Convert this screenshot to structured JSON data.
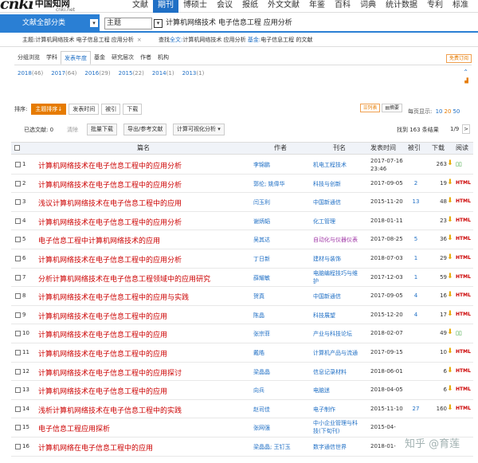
{
  "topnav": {
    "logo_text": "cnki",
    "logo_cn": "中国知网",
    "logo_domain": "cnki.net",
    "items": [
      "文献",
      "期刊",
      "博硕士",
      "会议",
      "报纸",
      "外文文献",
      "年鉴",
      "百科",
      "词典",
      "统计数据",
      "专利",
      "标准"
    ],
    "active_index": 1
  },
  "search": {
    "scope": "文献全部分类",
    "field": "主题",
    "query": "计算机网络技术 电子信息工程 应用分析"
  },
  "breadcrumb": {
    "left": "主题:计算机网络技术 电子信息工程 应用分析",
    "close": "×",
    "right_prefix": "查找",
    "right_bold": "全文:",
    "right_middle": "计算机网络技术 应用分析",
    "right_bold2": "基金:",
    "right_end": "电子信息工程 的文献"
  },
  "filters": {
    "items": [
      "分组浏览",
      "学科",
      "发表年度",
      "基金",
      "研究层次",
      "作者",
      "机构"
    ],
    "selected_index": 2,
    "right_button": "免费订阅"
  },
  "years": [
    {
      "y": "2018",
      "n": "(46)"
    },
    {
      "y": "2017",
      "n": "(64)"
    },
    {
      "y": "2016",
      "n": "(29)"
    },
    {
      "y": "2015",
      "n": "(22)"
    },
    {
      "y": "2014",
      "n": "(1)"
    },
    {
      "y": "2013",
      "n": "(1)"
    }
  ],
  "sort": {
    "label": "排序:",
    "options": [
      "主题排序↓",
      "发表时间",
      "被引",
      "下载"
    ],
    "active_index": 0
  },
  "view": {
    "list": "☰列表",
    "abstract": "▤摘要"
  },
  "pagesize": {
    "label": "每页显示:",
    "options": [
      "10",
      "20",
      "50"
    ],
    "active_index": 1
  },
  "actions": {
    "selected": "已选文献: 0",
    "clear": "清除",
    "batch_download": "批量下载",
    "export": "导出/参考文献",
    "viz": "计算可视化分析 ▾",
    "found": "找到 163 条结果",
    "page": "1/9",
    "next": ">"
  },
  "table": {
    "headers": {
      "title": "篇名",
      "author": "作者",
      "journal": "刊名",
      "date": "发表时间",
      "cite": "被引",
      "download": "下载",
      "read": "阅读"
    },
    "rows": [
      {
        "num": "1",
        "title": "计算机网络技术在电子信息工程中的应用分析",
        "author": "李锦鹏",
        "journal": "机电工程技术",
        "date": "2017-07-16 23:46",
        "cite": "",
        "download": "263",
        "read": "book"
      },
      {
        "num": "2",
        "title": "计算机网络技术在电子信息工程中的应用分析",
        "author": "郭伦; 姚偉华",
        "journal": "科技与创新",
        "date": "2017-09-05",
        "cite": "2",
        "download": "19",
        "read": "HTML"
      },
      {
        "num": "3",
        "title": "浅议计算机网络技术在电子信息工程中的应用",
        "author": "闫玉利",
        "journal": "中国新通信",
        "date": "2015-11-20",
        "cite": "13",
        "download": "48",
        "read": "HTML"
      },
      {
        "num": "4",
        "title": "计算机网络技术在电子信息工程中的应用分析",
        "author": "谢炳韬",
        "journal": "化工管理",
        "date": "2018-01-11",
        "cite": "",
        "download": "23",
        "read": "HTML"
      },
      {
        "num": "5",
        "title": "电子信息工程中计算机网络技术的应用",
        "author": "吴其达",
        "journal": "自动化与仪器仪表",
        "date": "2017-08-25",
        "cite": "5",
        "download": "36",
        "read": "HTML",
        "journal_purple": true
      },
      {
        "num": "6",
        "title": "计算机网络技术在电子信息工程中的应用分析",
        "author": "丁日新",
        "journal": "建材与装饰",
        "date": "2018-07-03",
        "cite": "1",
        "download": "29",
        "read": "HTML"
      },
      {
        "num": "7",
        "title": "分析计算机网络技术在电子信息工程领域中的应用研究",
        "author": "薛耀敏",
        "journal": "电脑编程技巧与维护",
        "date": "2017-12-03",
        "cite": "1",
        "download": "59",
        "read": "HTML"
      },
      {
        "num": "8",
        "title": "计算机网络技术在电子信息工程中的应用与实践",
        "author": "贺真",
        "journal": "中国新通信",
        "date": "2017-09-05",
        "cite": "4",
        "download": "16",
        "read": "HTML"
      },
      {
        "num": "9",
        "title": "计算机网络技术在电子信息工程中的应用",
        "author": "陈晶",
        "journal": "科技展望",
        "date": "2015-12-20",
        "cite": "4",
        "download": "17",
        "read": "HTML"
      },
      {
        "num": "10",
        "title": "计算机网络技术在电子信息工程中的应用",
        "author": "张宗菲",
        "journal": "产业与科技论坛",
        "date": "2018-02-07",
        "cite": "",
        "download": "49",
        "read": "book"
      },
      {
        "num": "11",
        "title": "计算机网络技术在电子信息工程中的应用",
        "author": "戴皓",
        "journal": "计算机产品与流通",
        "date": "2017-09-15",
        "cite": "",
        "download": "10",
        "read": "HTML"
      },
      {
        "num": "12",
        "title": "计算机网络技术在电子信息工程中的应用探讨",
        "author": "梁晶晶",
        "journal": "信息记录材料",
        "date": "2018-06-01",
        "cite": "",
        "download": "6",
        "read": "HTML"
      },
      {
        "num": "13",
        "title": "计算机网络技术在电子信息工程中的应用",
        "author": "向兵",
        "journal": "电脑迷",
        "date": "2018-04-05",
        "cite": "",
        "download": "6",
        "read": "HTML"
      },
      {
        "num": "14",
        "title": "浅析计算机网络技术在电子信息工程中的实践",
        "author": "赵司佳",
        "journal": "电子制作",
        "date": "2015-11-10",
        "cite": "27",
        "download": "160",
        "read": "HTML"
      },
      {
        "num": "15",
        "title": "电子信息工程应用探析",
        "author": "张网强",
        "journal": "中小企业管理与科技(下旬刊)",
        "date": "2015-04-",
        "cite": "",
        "download": "",
        "read": ""
      },
      {
        "num": "16",
        "title": "计算机网络在电子信息工程中的应用",
        "author": "梁晶晶; 王钉玉",
        "journal": "数字通信世界",
        "date": "2018-01-",
        "cite": "",
        "download": "",
        "read": ""
      }
    ]
  },
  "watermark": "知乎 @育莲"
}
